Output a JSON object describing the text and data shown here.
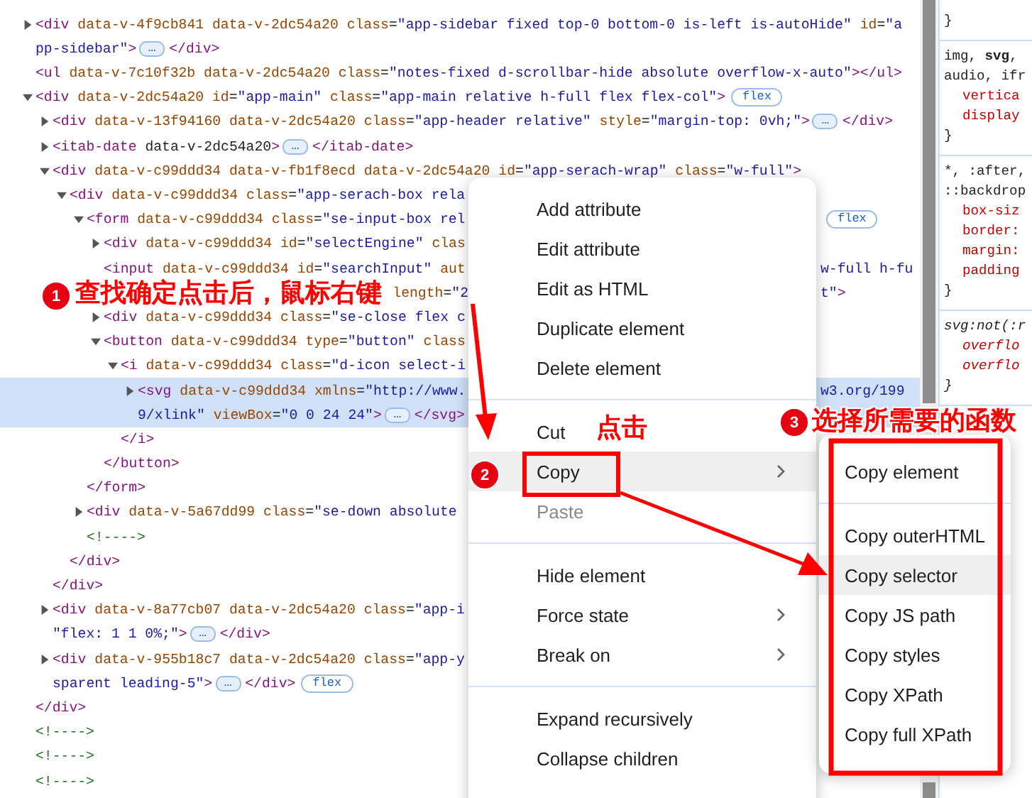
{
  "elements": {
    "nodes": [
      {
        "selected": false,
        "expanded": false,
        "lines": [
          {
            "text": "<div data-v-4f9cb841 data-v-2dc54a20 class=\"app-sidebar fixed top-0 bottom-0 is-left is-autoHide\" id=\"a"
          },
          {
            "text": "pp-sidebar\">",
            "more": "…",
            "after": "</div>"
          }
        ]
      },
      {
        "selected": false,
        "lines": [
          {
            "text": "<ul data-v-7c10f32b data-v-2dc54a20 class=\"notes-fixed d-scrollbar-hide absolute overflow-x-auto\"></ul>"
          }
        ]
      },
      {
        "selected": false,
        "expanded": true,
        "lines": [
          {
            "text": "<div data-v-2dc54a20 id=\"app-main\" class=\"app-main relative h-full flex flex-col\">",
            "badge": "flex"
          }
        ],
        "close": "</div>",
        "children": [
          {
            "selected": false,
            "expanded": false,
            "lines": [
              {
                "text": "<div data-v-13f94160 data-v-2dc54a20 class=\"app-header relative\" style=\"margin-top: 0vh;\">",
                "more": "…",
                "after": "</div>"
              }
            ]
          },
          {
            "selected": false,
            "expanded": false,
            "lines": [
              {
                "text": "<itab-date data-v-2dc54a20>",
                "more": "…",
                "after": "</itab-date>"
              }
            ]
          },
          {
            "selected": false,
            "expanded": true,
            "lines": [
              {
                "text": "<div data-v-c99ddd34 data-v-fb1f8ecd data-v-2dc54a20 id=\"app-serach-wrap\" class=\"w-full\">"
              }
            ],
            "close": "</div>",
            "children": [
              {
                "selected": false,
                "expanded": true,
                "lines": [
                  {
                    "text": "<div data-v-c99ddd34 class=\"app-serach-box rela"
                  }
                ],
                "close": "</div>",
                "children": [
                  {
                    "selected": false,
                    "expanded": true,
                    "lines": [
                      {
                        "text": "<form data-v-c99ddd34 class=\"se-input-box rel",
                        "tail_badge": "flex"
                      }
                    ],
                    "close": "</form>",
                    "children": [
                      {
                        "selected": false,
                        "expanded": false,
                        "lines": [
                          {
                            "text": "<div data-v-c99ddd34 id=\"selectEngine\" clas"
                          }
                        ]
                      },
                      {
                        "selected": false,
                        "lines": [
                          {
                            "text": "<input data-v-c99ddd34 id=\"searchInput\" aut",
                            "tail": "w-full h-fu"
                          }
                        ]
                      },
                      {
                        "selected": false,
                        "lines": [
                          {
                            "text": "length=\"2",
                            "overlaid": true,
                            "tail": "t\">"
                          }
                        ]
                      },
                      {
                        "selected": false,
                        "expanded": false,
                        "lines": [
                          {
                            "text": "<div data-v-c99ddd34 class=\"se-close flex c"
                          }
                        ]
                      },
                      {
                        "selected": false,
                        "expanded": true,
                        "lines": [
                          {
                            "text": "<button data-v-c99ddd34 type=\"button\" class"
                          }
                        ],
                        "close": "</button>",
                        "children": [
                          {
                            "selected": false,
                            "expanded": true,
                            "lines": [
                              {
                                "text": "<i data-v-c99ddd34 class=\"d-icon select-i"
                              }
                            ],
                            "close": "</i>",
                            "children": [
                              {
                                "selected": true,
                                "expanded": false,
                                "lines": [
                                  {
                                    "text": "<svg data-v-c99ddd34 xmlns=\"http://www.",
                                    "tail": "w3.org/199"
                                  },
                                  {
                                    "text": "9/xlink\" viewBox=\"0 0 24 24\">",
                                    "more": "…",
                                    "after": "</svg>"
                                  }
                                ]
                              }
                            ]
                          }
                        ]
                      }
                    ]
                  },
                  {
                    "selected": false,
                    "expanded": false,
                    "lines": [
                      {
                        "text": "<div data-v-5a67dd99 class=\"se-down absolute"
                      }
                    ]
                  },
                  {
                    "selected": false,
                    "lines": [
                      {
                        "text": "<!---->"
                      }
                    ]
                  }
                ]
              }
            ]
          },
          {
            "selected": false,
            "expanded": false,
            "lines": [
              {
                "text": "<div data-v-8a77cb07 data-v-2dc54a20 class=\"app-i"
              },
              {
                "text": "\"flex: 1 1 0%;\">",
                "more": "…",
                "after": "</div>"
              }
            ]
          },
          {
            "selected": false,
            "expanded": false,
            "lines": [
              {
                "text": "<div data-v-955b18c7 data-v-2dc54a20 class=\"app-y"
              },
              {
                "text": "sparent leading-5\">",
                "more": "…",
                "after": "</div>",
                "badge": "flex"
              }
            ]
          }
        ]
      },
      {
        "selected": false,
        "lines": [
          {
            "text": "<!---->"
          }
        ]
      },
      {
        "selected": false,
        "lines": [
          {
            "text": "<!---->"
          }
        ]
      },
      {
        "selected": false,
        "lines": [
          {
            "text": "<!---->"
          }
        ]
      }
    ]
  },
  "styles_panel": {
    "rules": [
      {
        "italic": false,
        "close": "}"
      },
      {
        "italic": false,
        "selector": [
          "img, **svg**,",
          "audio, ifr"
        ],
        "declarations": [
          "vertica",
          "display"
        ],
        "close": "}"
      },
      {
        "italic": false,
        "selector": [
          "*, :after,",
          "::backdrop"
        ],
        "declarations": [
          "box-siz",
          "border:",
          "margin:",
          "padding"
        ],
        "close": "}"
      },
      {
        "italic": true,
        "selector": [
          "svg:not(:r"
        ],
        "declarations": [
          "overflo",
          "overflo"
        ],
        "close": "}"
      }
    ]
  },
  "context_menu": {
    "groups": [
      [
        {
          "label": "Add attribute",
          "selected": false,
          "disabled": false,
          "submenu": false
        },
        {
          "label": "Edit attribute",
          "selected": false,
          "disabled": false,
          "submenu": false
        },
        {
          "label": "Edit as HTML",
          "selected": false,
          "disabled": false,
          "submenu": false
        },
        {
          "label": "Duplicate element",
          "selected": false,
          "disabled": false,
          "submenu": false
        },
        {
          "label": "Delete element",
          "selected": false,
          "disabled": false,
          "submenu": false
        }
      ],
      [
        {
          "label": "Cut",
          "selected": false,
          "disabled": false,
          "submenu": false
        },
        {
          "label": "Copy",
          "selected": true,
          "disabled": false,
          "submenu": true
        },
        {
          "label": "Paste",
          "selected": false,
          "disabled": true,
          "submenu": false
        }
      ],
      [
        {
          "label": "Hide element",
          "selected": false,
          "disabled": false,
          "submenu": false
        },
        {
          "label": "Force state",
          "selected": false,
          "disabled": false,
          "submenu": true
        },
        {
          "label": "Break on",
          "selected": false,
          "disabled": false,
          "submenu": true
        }
      ],
      [
        {
          "label": "Expand recursively",
          "selected": false,
          "disabled": false,
          "submenu": false
        },
        {
          "label": "Collapse children",
          "selected": false,
          "disabled": false,
          "submenu": false
        }
      ]
    ]
  },
  "copy_submenu": {
    "groups": [
      [
        {
          "label": "Copy element",
          "selected": false
        }
      ],
      [
        {
          "label": "Copy outerHTML",
          "selected": false
        },
        {
          "label": "Copy selector",
          "selected": true
        },
        {
          "label": "Copy JS path",
          "selected": false
        },
        {
          "label": "Copy styles",
          "selected": false
        },
        {
          "label": "Copy XPath",
          "selected": false
        },
        {
          "label": "Copy full XPath",
          "selected": false
        }
      ]
    ]
  },
  "annotations": [
    {
      "number": "1",
      "text": "查找确定点击后，鼠标右键"
    },
    {
      "number": "2",
      "text": "点击"
    },
    {
      "number": "3",
      "text": "选择所需要的函数"
    }
  ]
}
